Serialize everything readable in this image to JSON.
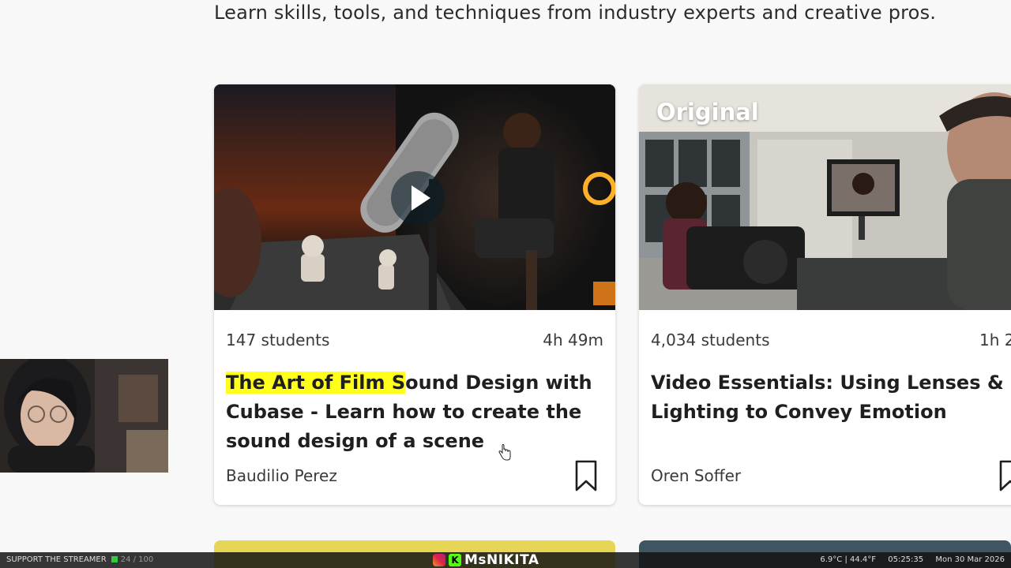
{
  "page": {
    "subtitle": "Learn skills, tools, and techniques from industry experts and creative pros."
  },
  "courses": [
    {
      "students": "147 students",
      "duration": "4h 49m",
      "title_highlight": "The Art of Film S",
      "title_rest": "ound Design with Cubase - Learn how to create the sound design of a scene",
      "author": "Baudilio Perez",
      "has_play_button": true
    },
    {
      "badge": "Original",
      "students": "4,034 students",
      "duration": "1h 2",
      "title": "Video Essentials: Using Lenses & Lighting to Convey Emotion",
      "author": "Oren Soffer"
    }
  ],
  "stream_overlay": {
    "support_label": "SUPPORT THE STREAMER",
    "support_count": "24 / 100",
    "streamer_name": "MsNIKITA",
    "kick_letter": "K",
    "temperature": "6.9°C | 44.4°F",
    "time": "05:25:35",
    "date": "Mon 30 Mar 2026"
  },
  "colors": {
    "highlight": "#ffff1a",
    "accent_card_yellow": "#e7d655",
    "progress_green": "#2ecc40"
  },
  "icons": [
    "play-icon",
    "bookmark-icon",
    "hand-cursor-icon",
    "instagram-icon",
    "kick-icon"
  ]
}
